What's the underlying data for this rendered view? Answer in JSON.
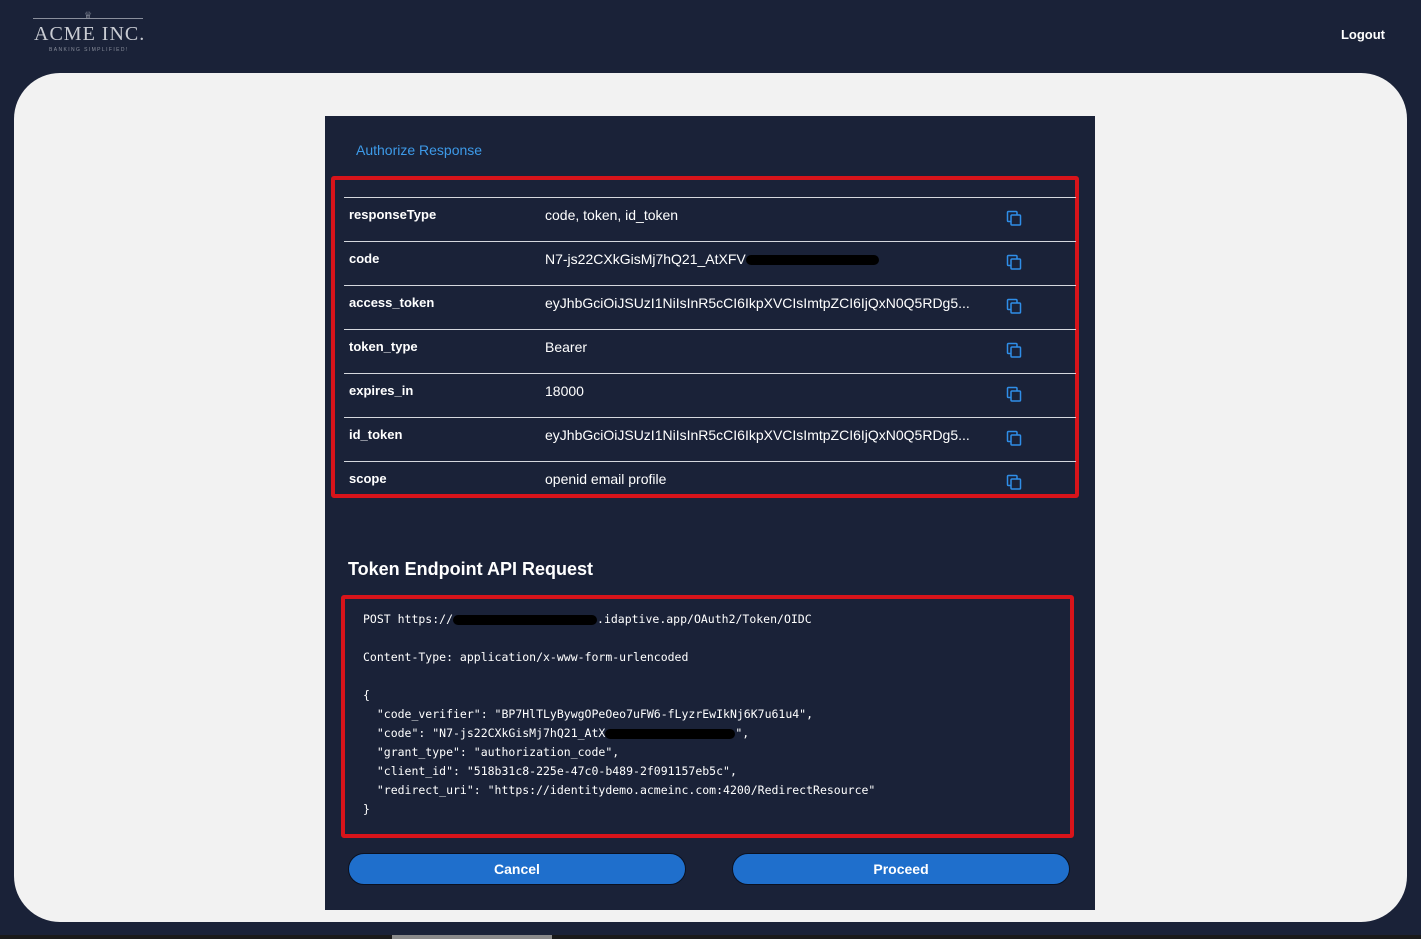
{
  "header": {
    "logo_crown": "♕",
    "logo_name": "ACME INC.",
    "logo_tagline": "BANKING SIMPLIFIED!",
    "logout_label": "Logout"
  },
  "panel": {
    "title": "Authorize Response",
    "rows": [
      {
        "key": "responseType",
        "value": "code, token, id_token"
      },
      {
        "key": "code",
        "value": "N7-js22CXkGisMj7hQ21_AtXFV"
      },
      {
        "key": "access_token",
        "value": "eyJhbGciOiJSUzI1NiIsInR5cCI6IkpXVCIsImtpZCI6IjQxN0Q5RDg5..."
      },
      {
        "key": "token_type",
        "value": "Bearer"
      },
      {
        "key": "expires_in",
        "value": "18000"
      },
      {
        "key": "id_token",
        "value": "eyJhbGciOiJSUzI1NiIsInR5cCI6IkpXVCIsImtpZCI6IjQxN0Q5RDg5..."
      },
      {
        "key": "scope",
        "value": "openid email profile"
      }
    ],
    "copy_icon": "copy-icon",
    "request_title": "Token Endpoint API Request",
    "request_lines": [
      "POST https://",
      "Content-Type: application/x-www-form-urlencoded",
      "{",
      "  \"code_verifier\": \"BP7HlTLyBywgOPeOeo7uFW6-fLyzrEwIkNj6K7u61u4\",",
      "  \"code\": \"N7-js22CXkGisMj7hQ21_AtX",
      "  \"grant_type\": \"authorization_code\",",
      "  \"client_id\": \"518b31c8-225e-47c0-b489-2f091157eb5c\",",
      "  \"redirect_uri\": \"https://identitydemo.acmeinc.com:4200/RedirectResource\"",
      "}"
    ],
    "request_url_suffix": ".idaptive.app/OAuth2/Token/OIDC",
    "request_code_suffix": "\",",
    "cancel_label": "Cancel",
    "proceed_label": "Proceed"
  },
  "colors": {
    "background": "#1a2238",
    "content": "#f2f2f2",
    "accent": "#1f6fcc",
    "link": "#3d9ae8",
    "highlight": "#d8141a"
  }
}
